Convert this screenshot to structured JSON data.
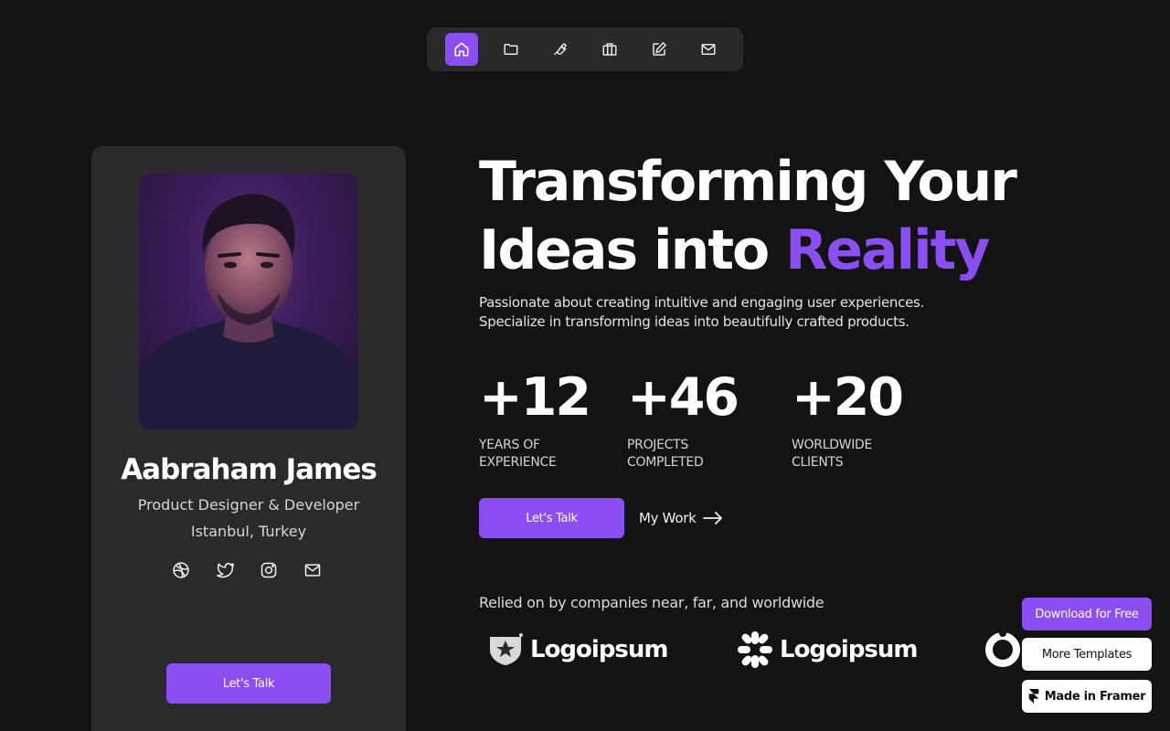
{
  "nav": {
    "items": [
      {
        "icon": "home-icon",
        "active": true
      },
      {
        "icon": "folder-icon",
        "active": false
      },
      {
        "icon": "wrench-icon",
        "active": false
      },
      {
        "icon": "briefcase-icon",
        "active": false
      },
      {
        "icon": "edit-icon",
        "active": false
      },
      {
        "icon": "mail-icon",
        "active": false
      }
    ]
  },
  "profile": {
    "name": "Aabraham James",
    "role": "Product Designer & Developer",
    "location": "Istanbul, Turkey",
    "socials": [
      "dribbble-icon",
      "twitter-icon",
      "instagram-icon",
      "mail-icon"
    ],
    "cta": "Let's Talk"
  },
  "hero": {
    "headline_part1": "Transforming Your",
    "headline_part2": "Ideas into ",
    "headline_accent": "Reality",
    "subtitle_line1": "Passionate about creating intuitive and engaging user experiences.",
    "subtitle_line2": "Specialize in transforming ideas into beautifully crafted products.",
    "stats": [
      {
        "value": "+12",
        "label_line1": "YEARS OF",
        "label_line2": "EXPERIENCE"
      },
      {
        "value": "+46",
        "label_line1": "PROJECTS",
        "label_line2": "COMPLETED"
      },
      {
        "value": "+20",
        "label_line1": "WORLDWIDE",
        "label_line2": "CLIENTS"
      }
    ],
    "primary_cta": "Let's Talk",
    "secondary_cta": "My Work"
  },
  "companies": {
    "heading": "Relied on by companies near, far, and worldwide",
    "logos": [
      "Logoipsum",
      "Logoipsum"
    ]
  },
  "framer": {
    "download": "Download for Free",
    "templates": "More Templates",
    "made_in": "Made in Framer"
  },
  "colors": {
    "accent": "#8b4ef2",
    "background": "#131313",
    "card": "#2a2a2c"
  }
}
